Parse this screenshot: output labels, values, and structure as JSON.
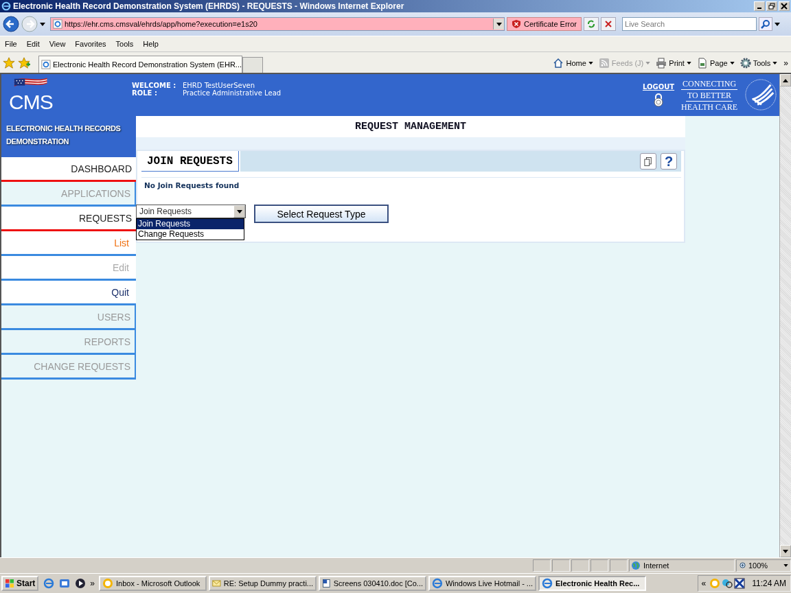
{
  "window": {
    "title": "Electronic Health Record Demonstration System (EHRDS) - REQUESTS - Windows Internet Explorer"
  },
  "address_bar": {
    "url": "https://ehr.cms.cmsval/ehrds/app/home?execution=e1s20",
    "certificate": "Certificate Error",
    "search_placeholder": "Live Search"
  },
  "menu_bar": [
    "File",
    "Edit",
    "View",
    "Favorites",
    "Tools",
    "Help"
  ],
  "tab": {
    "title": "Electronic Health Record Demonstration System (EHR..."
  },
  "command_bar": [
    {
      "label": "Home",
      "kind": "home",
      "disabled": false
    },
    {
      "label": "Feeds (J)",
      "kind": "feeds",
      "disabled": true
    },
    {
      "label": "Print",
      "kind": "print",
      "disabled": false
    },
    {
      "label": "Page",
      "kind": "page",
      "disabled": false
    },
    {
      "label": "Tools",
      "kind": "tools",
      "disabled": false
    }
  ],
  "header": {
    "logo": "CMS",
    "welcome_label": "WELCOME :",
    "welcome_value": "EHRD TestUserSeven",
    "role_label": "ROLE :",
    "role_value": "Practice Administrative Lead",
    "logout": "LOGOUT",
    "tagline": [
      "CONNECTING",
      "TO BETTER",
      "HEALTH CARE"
    ]
  },
  "sidebar": {
    "title": "ELECTRONIC HEALTH RECORDS DEMONSTRATION",
    "items": [
      {
        "label": "DASHBOARD",
        "disabled": false
      },
      {
        "label": "APPLICATIONS",
        "disabled": true
      },
      {
        "label": "REQUESTS",
        "disabled": false,
        "children": [
          {
            "label": "List",
            "selected": true,
            "disabled": false
          },
          {
            "label": "Edit",
            "selected": false,
            "disabled": true
          },
          {
            "label": "Quit",
            "selected": false,
            "disabled": false
          }
        ]
      },
      {
        "label": "USERS",
        "disabled": true
      },
      {
        "label": "REPORTS",
        "disabled": true
      },
      {
        "label": "CHANGE REQUESTS",
        "disabled": true
      }
    ]
  },
  "page_title": "REQUEST MANAGEMENT",
  "panel": {
    "tab": "JOIN REQUESTS",
    "help": "?",
    "message": "No Join Requests found",
    "select_value": "Join Requests",
    "options": [
      {
        "label": "Join Requests",
        "selected": true
      },
      {
        "label": "Change Requests",
        "selected": false
      }
    ],
    "button": "Select Request Type"
  },
  "status_bar": {
    "zone": "Internet",
    "zoom": "100%"
  },
  "taskbar": {
    "start": "Start",
    "chevron": "»",
    "tasks": [
      {
        "label": "Inbox - Microsoft Outlook",
        "kind": "mail",
        "selected": false
      },
      {
        "label": "RE: Setup Dummy practi...",
        "kind": "envelope",
        "selected": false
      },
      {
        "label": "Screens 030410.doc [Co...",
        "kind": "document",
        "selected": false
      },
      {
        "label": "Windows Live Hotmail - ...",
        "kind": "browser",
        "selected": false
      },
      {
        "label": "Electronic Health Rec...",
        "kind": "browser",
        "selected": true
      }
    ],
    "tray_chevron": "«",
    "time": "11:24 AM"
  }
}
